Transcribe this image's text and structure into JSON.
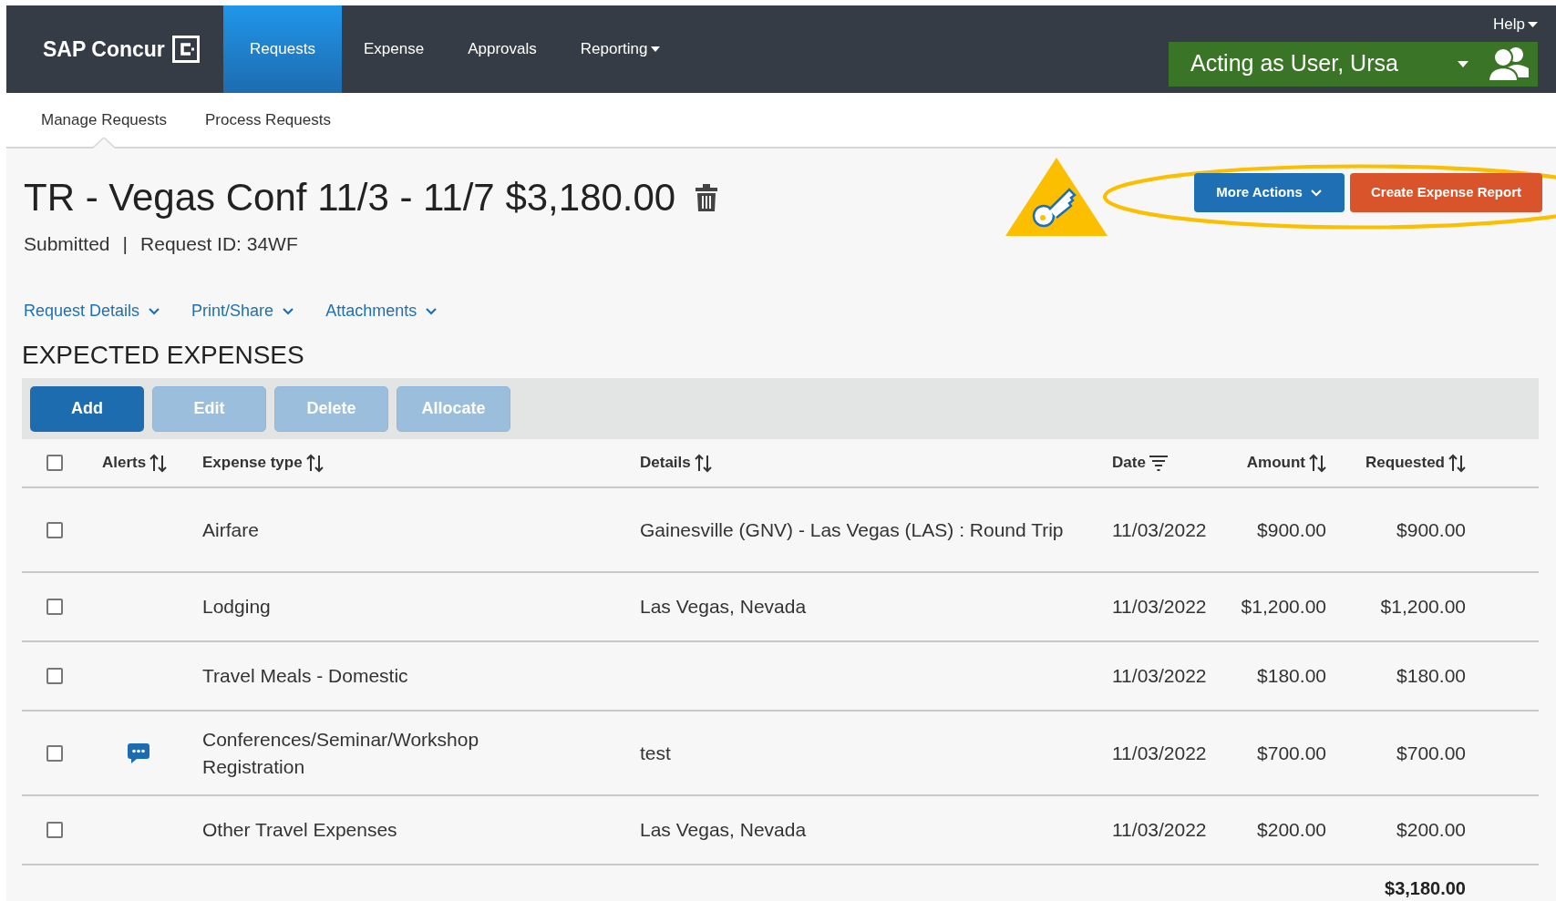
{
  "top_nav": {
    "logo": "SAP Concur",
    "tabs": [
      {
        "label": "Requests",
        "selected": true,
        "dropdown": false
      },
      {
        "label": "Expense",
        "selected": false,
        "dropdown": false
      },
      {
        "label": "Approvals",
        "selected": false,
        "dropdown": false
      },
      {
        "label": "Reporting",
        "selected": false,
        "dropdown": true
      }
    ],
    "help": "Help",
    "acting_as": "Acting as User, Ursa"
  },
  "sub_nav": [
    {
      "label": "Manage Requests",
      "selected": true
    },
    {
      "label": "Process Requests",
      "selected": false
    }
  ],
  "request": {
    "title": "TR - Vegas Conf 11/3 - 11/7 $3,180.00",
    "status": "Submitted",
    "separator": "|",
    "request_id": "Request ID: 34WF"
  },
  "actions": [
    {
      "label": "More Actions",
      "kind": "menu"
    },
    {
      "label": "Create Expense Report",
      "kind": "primary"
    }
  ],
  "links": [
    "Request Details",
    "Print/Share",
    "Attachments"
  ],
  "section_title": "EXPECTED EXPENSES",
  "toolbar": [
    {
      "label": "Add",
      "disabled": false
    },
    {
      "label": "Edit",
      "disabled": true
    },
    {
      "label": "Delete",
      "disabled": true
    },
    {
      "label": "Allocate",
      "disabled": true
    }
  ],
  "table": {
    "select_all": {
      "checked": false
    },
    "columns": [
      {
        "label": "Alerts",
        "sorted": false
      },
      {
        "label": "Expense type",
        "sorted": false
      },
      {
        "label": "Details",
        "sorted": false
      },
      {
        "label": "Date",
        "sorted": true
      },
      {
        "label": "Amount",
        "sorted": false
      },
      {
        "label": "Requested",
        "sorted": false
      }
    ],
    "rows": [
      {
        "checked": false,
        "comment": false,
        "expense_type": "Airfare",
        "details": "Gainesville (GNV) - Las Vegas (LAS) : Round Trip",
        "date": "11/03/2022",
        "amount": "$900.00",
        "requested": "$900.00"
      },
      {
        "checked": false,
        "comment": false,
        "expense_type": "Lodging",
        "details": "Las Vegas, Nevada",
        "date": "11/03/2022",
        "amount": "$1,200.00",
        "requested": "$1,200.00"
      },
      {
        "checked": false,
        "comment": false,
        "expense_type": "Travel Meals - Domestic",
        "date": "11/03/2022",
        "amount": "$180.00",
        "requested": "$180.00"
      },
      {
        "checked": false,
        "comment": true,
        "expense_type": "Conferences/Seminar/Workshop Registration",
        "details": "test",
        "date": "11/03/2022",
        "amount": "$700.00",
        "requested": "$700.00"
      },
      {
        "checked": false,
        "comment": false,
        "expense_type": "Other Travel Expenses",
        "details": "Las Vegas, Nevada",
        "date": "11/03/2022",
        "amount": "$200.00",
        "requested": "$200.00"
      }
    ],
    "total": "$3,180.00"
  }
}
